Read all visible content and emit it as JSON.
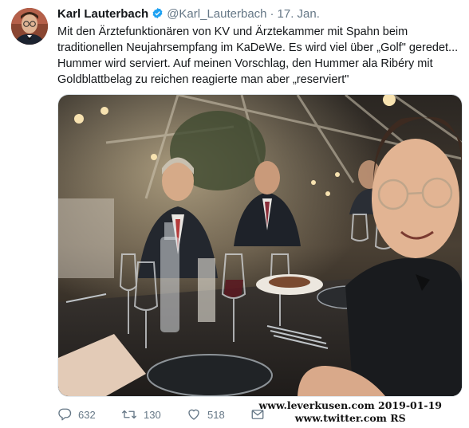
{
  "tweet": {
    "author_name": "Karl Lauterbach",
    "handle": "@Karl_Lauterbach",
    "separator": "·",
    "date": "17. Jan.",
    "text_lines": [
      "Mit den Ärztefunktionären von KV und Ärztekammer mit Spahn beim",
      "traditionellen Neujahrsempfang im KaDeWe. Es wird viel über „Golf\" geredet...",
      "Hummer wird serviert. Auf meinen Vorschlag, den Hummer ala Ribéry mit",
      "Goldblattbelag zu reichen reagierte man aber „reserviert\""
    ]
  },
  "actions": {
    "reply_count": "632",
    "retweet_count": "130",
    "like_count": "518"
  },
  "watermark": {
    "line1": "www.leverkusen.com 2019-01-19",
    "line2": "www.twitter.com RS"
  },
  "icons": {
    "verified": "verified-badge-icon",
    "reply": "reply-icon",
    "retweet": "retweet-icon",
    "like": "heart-icon",
    "dm": "envelope-icon"
  },
  "colors": {
    "verified": "#1da1f2",
    "secondary_text": "#657786"
  }
}
